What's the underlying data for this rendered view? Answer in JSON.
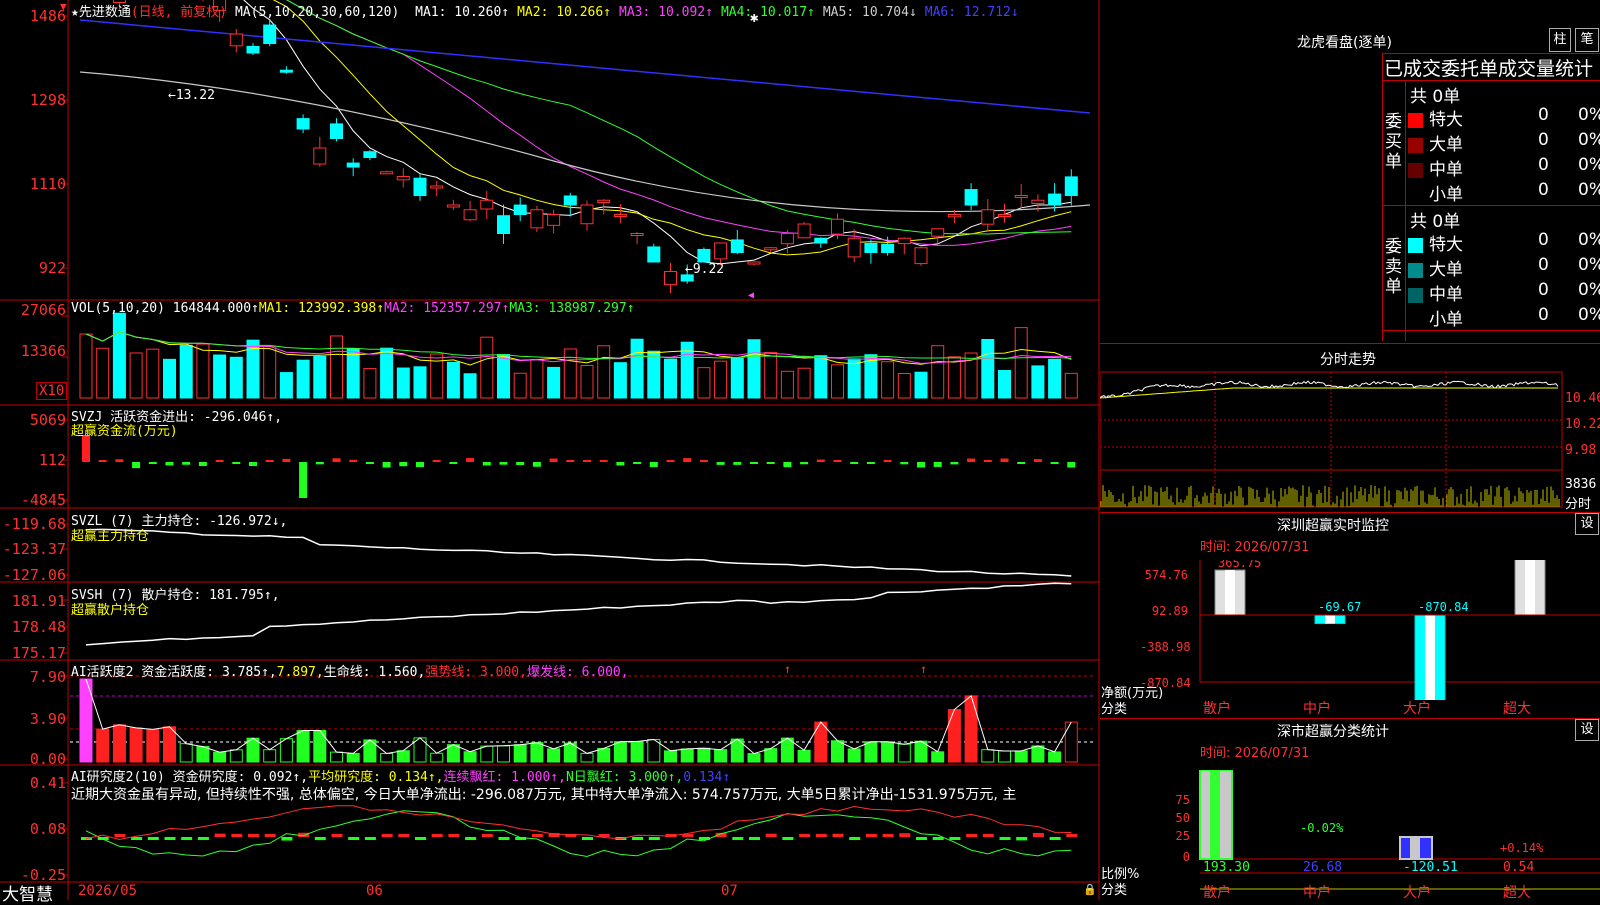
{
  "main": {
    "title_name": "★先进数通",
    "title_mode": "(日线, 前复权)",
    "ma_prefix": "MA(5,10,20,30,60,120)",
    "ma": [
      {
        "label": "MA1: 10.260↑",
        "color": "#ffffff"
      },
      {
        "label": "MA2: 10.266↑",
        "color": "#ffff00"
      },
      {
        "label": "MA3: 10.092↑",
        "color": "#ff40ff"
      },
      {
        "label": "MA4: 10.017↑",
        "color": "#30ff30"
      },
      {
        "label": "MA5: 10.704↓",
        "color": "#cccccc"
      },
      {
        "label": "MA6: 12.712↓",
        "color": "#4040ff"
      }
    ],
    "y_labels": [
      "1486",
      "1298",
      "1110",
      "922"
    ],
    "hi_label": "←13.22",
    "lo_label": "←9.22"
  },
  "vol": {
    "title": "VOL(5,10,20)",
    "value": "164844.000↑",
    "ma1": "MA1: 123992.398↑",
    "ma2": "MA2: 152357.297↑",
    "ma3": "MA3: 138987.297↑",
    "y_labels": [
      "27066",
      "13366"
    ],
    "unit": "X10"
  },
  "svzj": {
    "title": "SVZJ  活跃资金进出: -296.046↑,",
    "sub": "超赢资金流(万元)",
    "y_labels": [
      "5069",
      "112",
      "-4845"
    ]
  },
  "svzl": {
    "title": "SVZL (7) 主力持仓: -126.972↓,",
    "sub": "超赢主力持仓",
    "y_labels": [
      "-119.68",
      "-123.37",
      "-127.06"
    ]
  },
  "svsh": {
    "title": "SVSH (7) 散户持仓: 181.795↑,",
    "sub": "超赢散户持仓",
    "y_labels": [
      "181.91",
      "178.48",
      "175.17"
    ]
  },
  "ai1": {
    "prefix": "AI活跃度2 资金活跃度: 3.785↑,",
    "v2": "7.897,",
    "v3": "生命线: 1.560,",
    "v4": "强势线: 3.000,",
    "v5": "爆发线: 6.000,",
    "y_labels": [
      "7.90",
      "3.90",
      "0.00"
    ]
  },
  "ai2": {
    "prefix": "AI研究度2(10) 资金研究度: 0.092↑,",
    "v2": "平均研究度: 0.134↑,",
    "v3": "连续飘红: 1.000↑,",
    "v4": "N日飘红: 3.000↑,",
    "v5": "0.134↑",
    "comment": "近期大资金虽有异动, 但持续性不强, 总体偏空, 今日大单净流出: -296.087万元, 其中特大单净流入: 574.757万元, 大单5日累计净出-1531.975万元, 主",
    "y_labels": [
      "0.41",
      "0.08",
      "-0.25"
    ]
  },
  "xaxis": {
    "logo": "大智慧",
    "labels": [
      "2026/05",
      "06",
      "07"
    ]
  },
  "right": {
    "lhb_title": "龙虎看盘(逐单)",
    "btn_bar": "柱",
    "btn_bi": "笔",
    "stats_title": "已成交委托单成交量统计",
    "buy_label": "委买单",
    "sell_label": "委卖单",
    "buy_total": "共 0单",
    "sell_total": "共 0单",
    "buy_rows": [
      {
        "name": "特大",
        "count": "0",
        "pct": "0%",
        "color": "#ff0000"
      },
      {
        "name": "大单",
        "count": "0",
        "pct": "0%",
        "color": "#990000"
      },
      {
        "name": "中单",
        "count": "0",
        "pct": "0%",
        "color": "#660000"
      },
      {
        "name": "小单",
        "count": "0",
        "pct": "0%",
        "color": "#000000"
      }
    ],
    "sell_rows": [
      {
        "name": "特大",
        "count": "0",
        "pct": "0%",
        "color": "#00ffff"
      },
      {
        "name": "大单",
        "count": "0",
        "pct": "0%",
        "color": "#008c8c"
      },
      {
        "name": "中单",
        "count": "0",
        "pct": "0%",
        "color": "#006464"
      },
      {
        "name": "小单",
        "count": "0",
        "pct": "0%",
        "color": "#000000"
      }
    ],
    "fs_title": "分时走势",
    "fs_y": [
      "10.46",
      "10.22",
      "9.98"
    ],
    "fs_vol": "3836",
    "fs_unit": "分时",
    "mon_title": "深圳超赢实时监控",
    "mon_btn": "设",
    "mon_time": "时间: 2026/07/31",
    "mon_y": [
      "574.76",
      "92.89",
      "-388.98",
      "-870.84"
    ],
    "mon_unit1": "净额(万元)",
    "mon_unit2": "分类",
    "mon_bars": [
      {
        "cat": "散户",
        "value": 365.75,
        "label": "365.75"
      },
      {
        "cat": "中户",
        "value": -69.67,
        "label": "-69.67"
      },
      {
        "cat": "大户",
        "value": -870.84,
        "label": "-870.84"
      },
      {
        "cat": "超大",
        "value": 574.76,
        "label": "574.76"
      }
    ],
    "cls_title": "深市超赢分类统计",
    "cls_btn": "设",
    "cls_time": "时间: 2026/07/31",
    "cls_y": [
      "75",
      "50",
      "25",
      "0"
    ],
    "cls_unit1": "比例%",
    "cls_unit2": "分类",
    "cls_pct": [
      "-0.02%",
      "+0.14%"
    ],
    "cls_vals": [
      "193.30",
      "26.68",
      "-120.51",
      "0.54"
    ],
    "cls_cats": [
      "散户",
      "中户",
      "大户",
      "超大"
    ]
  }
}
